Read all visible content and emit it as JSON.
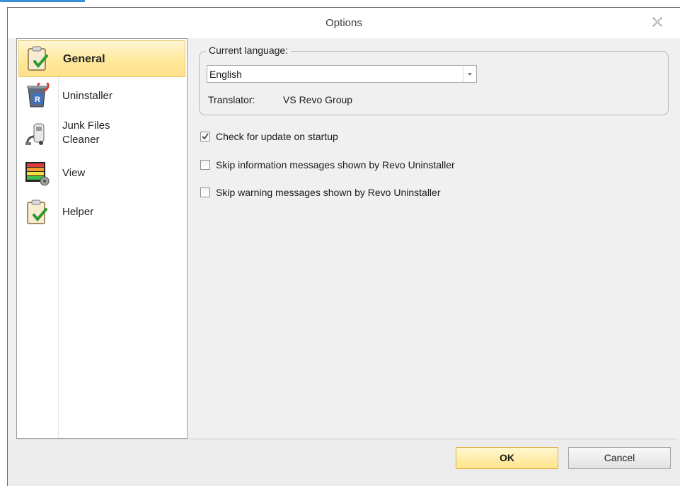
{
  "window": {
    "title": "Options"
  },
  "sidebar": {
    "items": [
      {
        "label": "General",
        "icon": "clipboard-check-icon",
        "selected": true
      },
      {
        "label": "Uninstaller",
        "icon": "recycle-bin-icon",
        "selected": false
      },
      {
        "label": "Junk Files Cleaner",
        "icon": "vacuum-cleaner-icon",
        "selected": false
      },
      {
        "label": "View",
        "icon": "color-grid-icon",
        "selected": false
      },
      {
        "label": "Helper",
        "icon": "clipboard-check-icon",
        "selected": false
      }
    ]
  },
  "language": {
    "group_label": "Current language:",
    "value": "English",
    "translator_label": "Translator:",
    "translator_value": "VS Revo Group"
  },
  "options": [
    {
      "label": "Check for update on startup",
      "checked": true
    },
    {
      "label": "Skip information messages shown by Revo Uninstaller",
      "checked": false
    },
    {
      "label": "Skip warning messages shown by Revo Uninstaller",
      "checked": false
    }
  ],
  "buttons": {
    "ok": "OK",
    "cancel": "Cancel"
  },
  "colors": {
    "selection_bg": "#ffe99a",
    "ok_button": "#ffe48a",
    "accent": "#3a8fd6"
  }
}
